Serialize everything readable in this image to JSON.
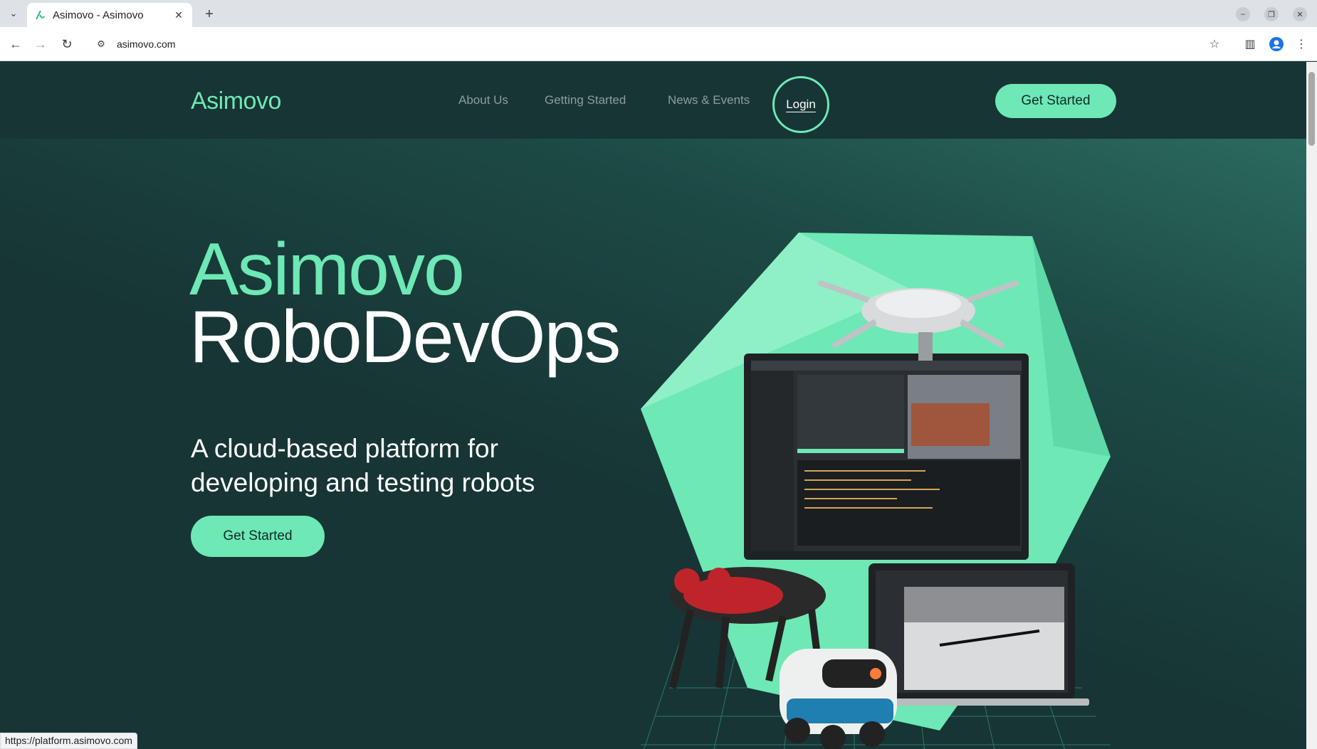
{
  "browser": {
    "tab_title": "Asimovo - Asimovo",
    "url": "asimovo.com",
    "status_url": "https://platform.asimovo.com"
  },
  "site": {
    "logo": "Asimovo",
    "nav": [
      "About Us",
      "Getting Started",
      "News & Events"
    ],
    "login": "Login",
    "cta_top": "Get Started"
  },
  "hero": {
    "line1": "Asimovo",
    "line2": "RoboDevOps",
    "subtitle": "A cloud-based platform for developing and testing robots",
    "cta": "Get Started"
  },
  "colors": {
    "accent": "#6ee8b4",
    "background": "#173535"
  }
}
